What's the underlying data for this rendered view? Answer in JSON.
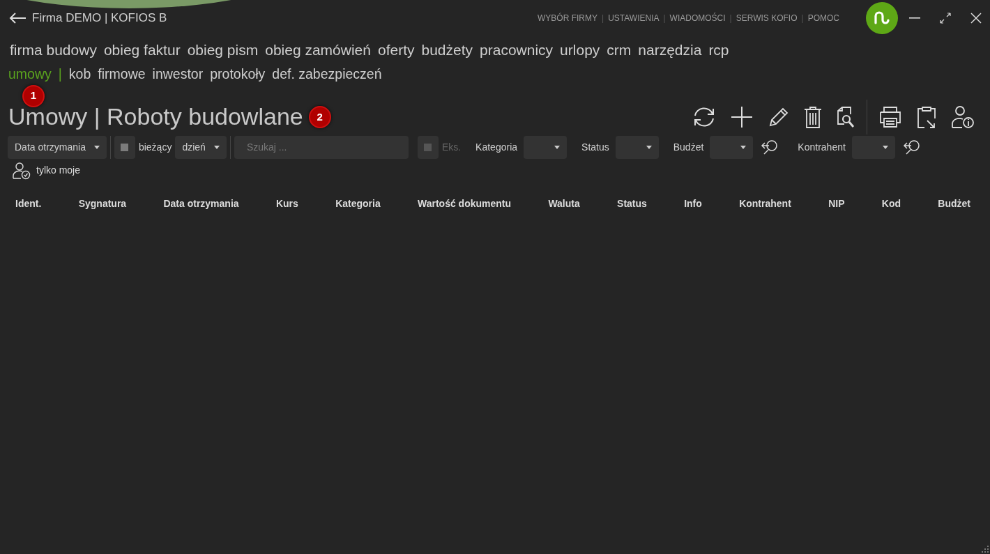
{
  "header": {
    "title": "Firma DEMO | KOFIOS B"
  },
  "top_links": [
    "WYBÓR FIRMY",
    "USTAWIENIA",
    "WIADOMOŚCI",
    "SERWIS KOFIO",
    "POMOC"
  ],
  "top_link_separator": "|",
  "menu": [
    {
      "label": "firma budowy",
      "selected": false
    },
    {
      "label": "obieg faktur",
      "selected": false
    },
    {
      "label": "obieg pism",
      "selected": false
    },
    {
      "label": "obieg zamówień",
      "selected": false
    },
    {
      "label": "oferty",
      "selected": false
    },
    {
      "label": "budżety",
      "selected": false
    },
    {
      "label": "pracownicy",
      "selected": false
    },
    {
      "label": "urlopy",
      "selected": false
    },
    {
      "label": "crm",
      "selected": false
    },
    {
      "label": "narzędzia",
      "selected": false
    },
    {
      "label": "rcp",
      "selected": false
    }
  ],
  "submenu_separator": "|",
  "submenu": [
    {
      "label": "umowy",
      "selected": true
    },
    {
      "label": "kob",
      "selected": false
    },
    {
      "label": "firmowe",
      "selected": false
    },
    {
      "label": "inwestor",
      "selected": false
    },
    {
      "label": "protokoły",
      "selected": false
    },
    {
      "label": "def. zabezpieczeń",
      "selected": false
    }
  ],
  "markers": [
    "1",
    "2"
  ],
  "page_title": "Umowy | Roboty budowlane",
  "filters": [
    {
      "kind": "dropdown",
      "value": "Data otrzymania"
    },
    {
      "kind": "checkbox",
      "label": "bieżący",
      "checked": true,
      "disabled": false
    },
    {
      "kind": "dropdown",
      "value": "dzień"
    },
    {
      "kind": "search",
      "placeholder": "Szukaj ..."
    },
    {
      "kind": "checkbox",
      "label": "Eks.",
      "checked": true,
      "disabled": true
    },
    {
      "kind": "dropdown",
      "label": "Kategoria",
      "clearable": false
    },
    {
      "kind": "dropdown",
      "label": "Status",
      "clearable": false
    },
    {
      "kind": "dropdown",
      "label": "Budżet",
      "clearable": true
    },
    {
      "kind": "dropdown",
      "label": "Kontrahent",
      "clearable": true
    }
  ],
  "owner_filter": {
    "label": "tylko moje"
  },
  "columns": [
    "Ident.",
    "Sygnatura",
    "Data otrzymania",
    "Kurs",
    "Kategoria",
    "Wartość dokumentu",
    "Waluta",
    "Status",
    "Info",
    "Kontrahent",
    "NIP",
    "Kod",
    "Budżet"
  ]
}
